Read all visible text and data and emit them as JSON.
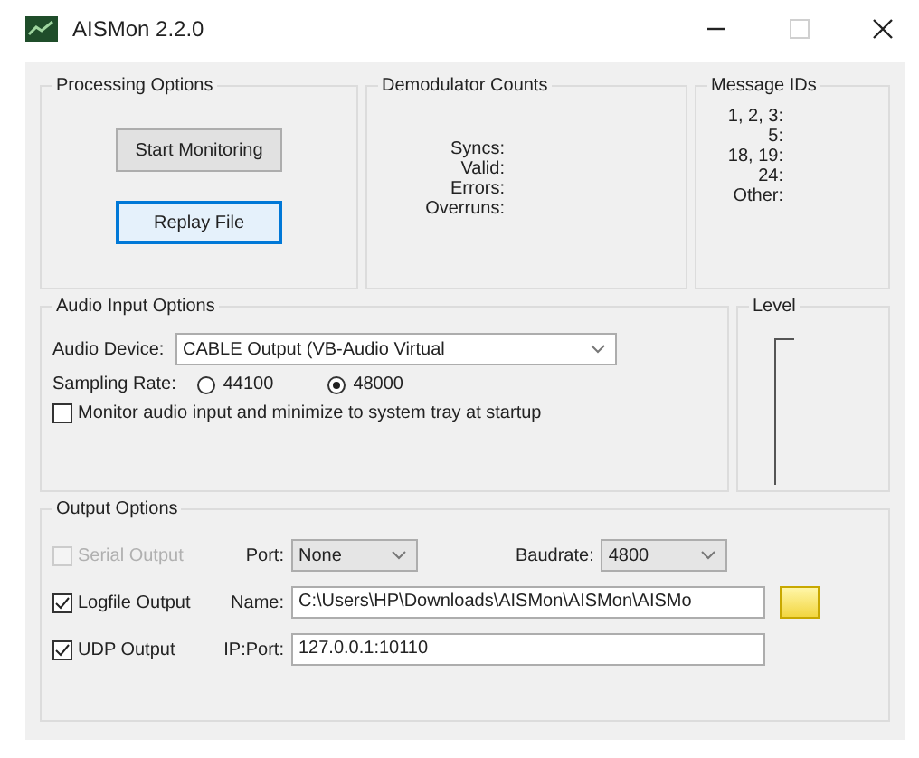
{
  "window": {
    "title": "AISMon 2.2.0",
    "maximize_disabled": true
  },
  "processing_options": {
    "title": "Processing Options",
    "buttons": [
      {
        "label": "Start Monitoring",
        "focused": false
      },
      {
        "label": "Replay File",
        "focused": true
      }
    ]
  },
  "demodulator_counts": {
    "title": "Demodulator Counts",
    "labels": [
      "Syncs:",
      "Valid:",
      "Errors:",
      "Overruns:"
    ]
  },
  "message_ids": {
    "title": "Message IDs",
    "labels": [
      "1, 2, 3:",
      "5:",
      "18, 19:",
      "24:",
      "Other:"
    ]
  },
  "audio_input": {
    "title": "Audio Input Options",
    "device_label": "Audio Device:",
    "device_value": "CABLE Output (VB-Audio Virtual",
    "sampling_label": "Sampling Rate:",
    "rates": [
      {
        "label": "44100",
        "selected": false
      },
      {
        "label": "48000",
        "selected": true
      }
    ],
    "monitor": {
      "label": "Monitor audio input and minimize to system tray at startup",
      "checked": false
    }
  },
  "level_meter": {
    "title": "Level",
    "level": 0
  },
  "output_options": {
    "title": "Output Options",
    "rows": [
      {
        "kind": "serial",
        "label": "Serial Output",
        "checked": false,
        "disabled": true,
        "port_label": "Port:",
        "port": "None",
        "baud_label": "Baudrate:",
        "baud": "4800"
      },
      {
        "kind": "file",
        "label": "Logfile Output",
        "checked": true,
        "disabled": false,
        "field_label": "Name:",
        "value": "C:\\Users\\HP\\Downloads\\AISMon\\AISMon\\AISMo"
      },
      {
        "kind": "udp",
        "label": "UDP Output",
        "checked": true,
        "disabled": false,
        "field_label": "IP:Port:",
        "value": "127.0.0.1:10110"
      }
    ]
  }
}
